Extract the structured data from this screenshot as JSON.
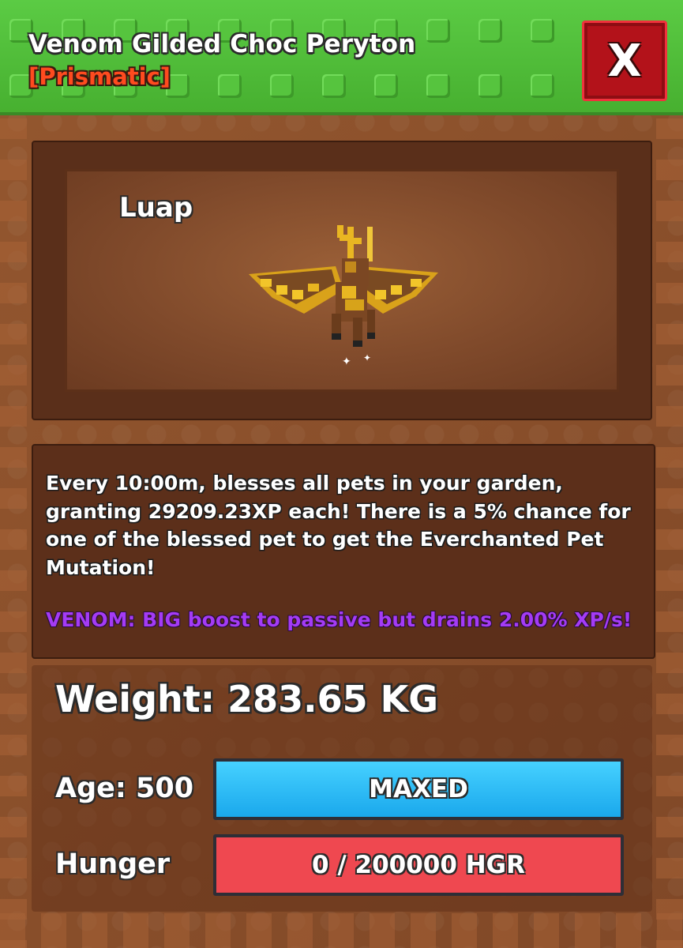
{
  "header": {
    "title": "Venom Gilded Choc Peryton",
    "rarity": "[Prismatic]",
    "close_label": "X"
  },
  "preview": {
    "pet_name": "Luap",
    "pet_icon": "peryton-pet-icon"
  },
  "description": {
    "text": "Every 10:00m, blesses all pets in your garden, granting 29209.23XP each! There is a 5% chance for one of the blessed pet to get the Everchanted Pet Mutation!",
    "mutation": "VENOM: BIG boost to passive but drains 2.00% XP/s!"
  },
  "stats": {
    "weight": "Weight: 283.65 KG",
    "age_label": "Age: 500",
    "age_bar_text": "MAXED",
    "age_progress": 1.0,
    "hunger_label": "Hunger",
    "hunger_bar_text": "0 / 200000 HGR",
    "hunger_progress": 1.0
  },
  "colors": {
    "header_green": "#4fbe38",
    "rarity_red": "#ff4b1f",
    "close_red": "#b3121a",
    "mutation_purple": "#a43bf5",
    "age_blue": "#2bb8f5",
    "hunger_red": "#ef4850"
  }
}
